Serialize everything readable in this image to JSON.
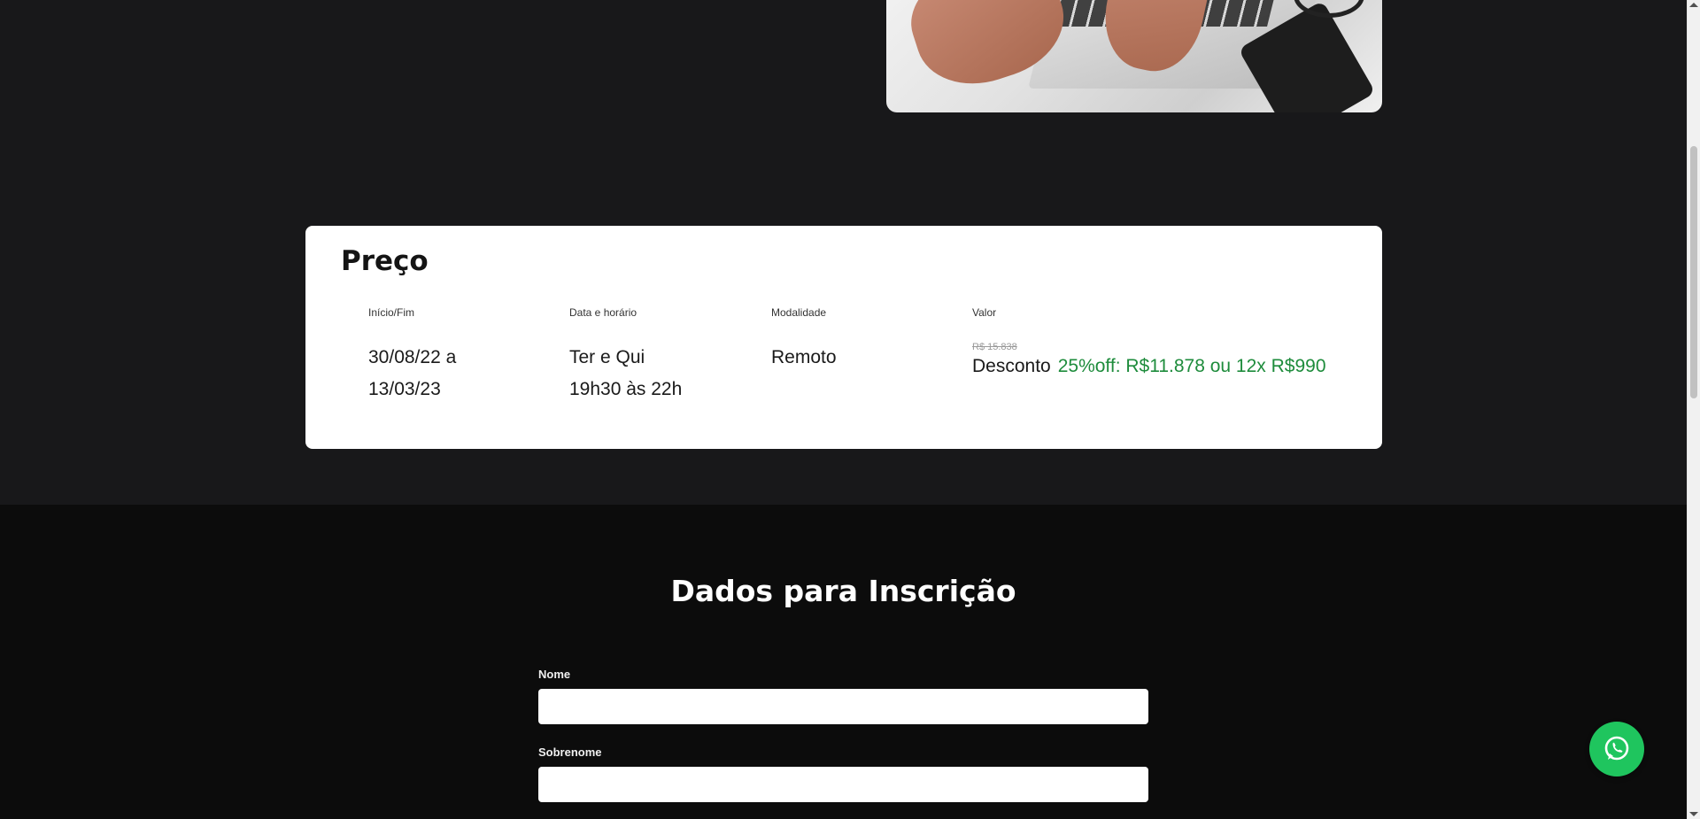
{
  "price_card": {
    "title": "Preço",
    "columns": [
      {
        "label": "Início/Fim",
        "value_lines": [
          "30/08/22 a",
          "13/03/23"
        ]
      },
      {
        "label": "Data e horário",
        "value_lines": [
          "Ter e Qui",
          "19h30 às 22h"
        ]
      },
      {
        "label": "Modalidade",
        "value_lines": [
          "Remoto"
        ]
      },
      {
        "label": "Valor"
      }
    ],
    "old_price": "R$ 15.838",
    "discount_label": "Desconto",
    "discount_value": "25%off: R$11.878 ou 12x R$990",
    "discount_color": "#1e8c3c"
  },
  "form": {
    "title": "Dados para Inscrição",
    "fields": [
      {
        "label": "Nome",
        "value": ""
      },
      {
        "label": "Sobrenome",
        "value": ""
      }
    ]
  },
  "whatsapp": {
    "icon": "whatsapp-icon",
    "color": "#1fc55e"
  },
  "colors": {
    "background": "#18181a",
    "form_background": "#0c0c0c"
  }
}
